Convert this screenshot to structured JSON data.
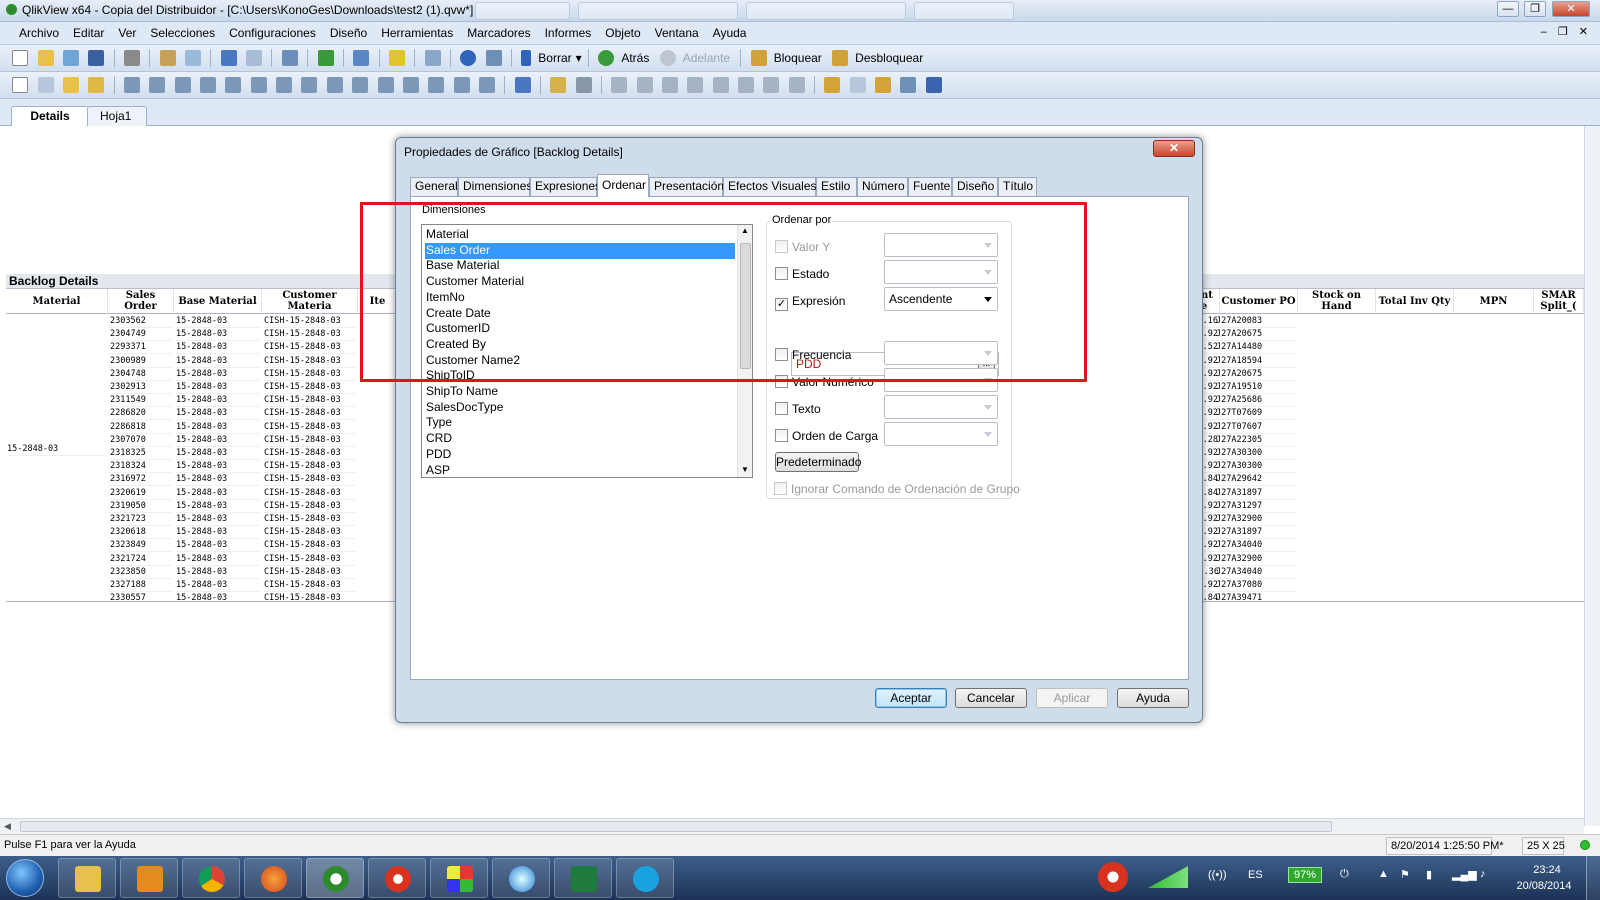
{
  "window": {
    "title": "QlikView x64 - Copia del Distribuidor - [C:\\Users\\KonoGes\\Downloads\\test2 (1).qvw*]",
    "controls": [
      "—",
      "❐",
      "✕"
    ]
  },
  "menu": [
    "Archivo",
    "Editar",
    "Ver",
    "Selecciones",
    "Configuraciones",
    "Diseño",
    "Herramientas",
    "Marcadores",
    "Informes",
    "Objeto",
    "Ventana",
    "Ayuda"
  ],
  "toolbar": {
    "borrar": "Borrar",
    "atras": "Atrás",
    "adelante": "Adelante",
    "bloquear": "Bloquear",
    "desbloquear": "Desbloquear"
  },
  "sheet_tabs": [
    "Details",
    "Hoja1"
  ],
  "backlog": {
    "title": "Backlog Details",
    "left_headers": [
      "Material",
      "Sales Order",
      "Base Material",
      "Customer Materia",
      "Ite"
    ],
    "right_headers": [
      "ment lue",
      "Customer PO",
      "Stock on Hand",
      "Total Inv Qty",
      "MPN",
      "SMAR Split_("
    ],
    "material_value": "15-2848-03",
    "rows": [
      [
        "2303562",
        "15-2848-03",
        "CISH-15-2848-03",
        "$220.16",
        "J27A20083"
      ],
      [
        "2304749",
        "15-2848-03",
        "CISH-15-2848-03",
        "$233.92",
        "J27A20675"
      ],
      [
        "2293371",
        "15-2848-03",
        "CISH-15-2848-03",
        "$27.52",
        "J27A14480"
      ],
      [
        "2300989",
        "15-2848-03",
        "CISH-15-2848-03",
        "$233.92",
        "J27A18594"
      ],
      [
        "2304748",
        "15-2848-03",
        "CISH-15-2848-03",
        "$233.92",
        "J27A20675"
      ],
      [
        "2302913",
        "15-2848-03",
        "CISH-15-2848-03",
        "$233.92",
        "J27A19510"
      ],
      [
        "2311549",
        "15-2848-03",
        "CISH-15-2848-03",
        "$233.92",
        "J27A25686"
      ],
      [
        "2286820",
        "15-2848-03",
        "CISH-15-2848-03",
        "$233.92",
        "J27T07609"
      ],
      [
        "2286818",
        "15-2848-03",
        "CISH-15-2848-03",
        "$233.92",
        "J27T07607"
      ],
      [
        "2307070",
        "15-2848-03",
        "CISH-15-2848-03",
        "$385.28",
        "J27A22305"
      ],
      [
        "2318325",
        "15-2848-03",
        "CISH-15-2848-03",
        "$233.92",
        "J27A30300"
      ],
      [
        "2318324",
        "15-2848-03",
        "CISH-15-2848-03",
        "$233.92",
        "J27A30300"
      ],
      [
        "2316972",
        "15-2848-03",
        "CISH-15-2848-03",
        "$467.84",
        "J27A29642"
      ],
      [
        "2320619",
        "15-2848-03",
        "CISH-15-2848-03",
        "$467.84",
        "J27A31897"
      ],
      [
        "2319050",
        "15-2848-03",
        "CISH-15-2848-03",
        "$233.92",
        "J27A31297"
      ],
      [
        "2321723",
        "15-2848-03",
        "CISH-15-2848-03",
        "$233.92",
        "J27A32900"
      ],
      [
        "2320618",
        "15-2848-03",
        "CISH-15-2848-03",
        "$233.92",
        "J27A31897"
      ],
      [
        "2323849",
        "15-2848-03",
        "CISH-15-2848-03",
        "$233.92",
        "J27A34040"
      ],
      [
        "2321724",
        "15-2848-03",
        "CISH-15-2848-03",
        "$233.92",
        "J27A32900"
      ],
      [
        "2323850",
        "15-2848-03",
        "CISH-15-2848-03",
        "$1871.36",
        "J27A34040"
      ],
      [
        "2327188",
        "15-2848-03",
        "CISH-15-2848-03",
        "$233.92",
        "J27A37080"
      ],
      [
        "2330557",
        "15-2848-03",
        "CISH-15-2848-03",
        "$467.84",
        "J27A39471"
      ]
    ]
  },
  "dialog": {
    "title": "Propiedades de Gráfico [Backlog Details]",
    "close": "✕",
    "tabs": [
      "General",
      "Dimensiones",
      "Expresiones",
      "Ordenar",
      "Presentación",
      "Efectos Visuales",
      "Estilo",
      "Número",
      "Fuente",
      "Diseño",
      "Título"
    ],
    "active_tab": "Ordenar",
    "dimensions_label": "Dimensiones",
    "dimensions": [
      "Material",
      "Sales Order",
      "Base Material",
      "Customer Material",
      "ItemNo",
      "Create Date",
      "CustomerID",
      "Created By",
      "Customer Name2",
      "ShipToID",
      "ShipTo Name",
      "SalesDocType",
      "Type",
      "CRD",
      "PDD",
      "ASP"
    ],
    "selected_dimension": "Sales Order",
    "sort_group_label": "Ordenar por",
    "sort_options": {
      "valor_y": {
        "label": "Valor Y",
        "checked": false,
        "enabled": false,
        "value": ""
      },
      "estado": {
        "label": "Estado",
        "checked": false,
        "enabled": true,
        "value": ""
      },
      "expresion": {
        "label": "Expresión",
        "checked": true,
        "enabled": true,
        "value": "Ascendente"
      },
      "frecuencia": {
        "label": "Frecuencia",
        "checked": false,
        "enabled": true,
        "value": ""
      },
      "valor_numerico": {
        "label": "Valor Numérico",
        "checked": false,
        "enabled": true,
        "value": ""
      },
      "texto": {
        "label": "Texto",
        "checked": false,
        "enabled": true,
        "value": ""
      },
      "orden_carga": {
        "label": "Orden de Carga",
        "checked": false,
        "enabled": true,
        "value": ""
      }
    },
    "expression_text": "PDD",
    "expression_button": "...",
    "default_button": "Predeterminado",
    "ignore_group_label": "Ignorar Comando de Ordenación de Grupo",
    "buttons": {
      "ok": "Aceptar",
      "cancel": "Cancelar",
      "apply": "Aplicar",
      "help": "Ayuda"
    }
  },
  "statusbar": {
    "help": "Pulse F1 para ver la Ayuda",
    "datetime": "8/20/2014 1:25:50 PM*",
    "grid": "25 X 25"
  },
  "taskbar": {
    "language": "ES",
    "battery": "97%",
    "time": "23:24",
    "date": "20/08/2014"
  },
  "colors": {
    "highlight_box": "#e0141e",
    "selection": "#3399ff",
    "expression_text": "#b01a1a",
    "status_dot": "#2fbf2f"
  }
}
